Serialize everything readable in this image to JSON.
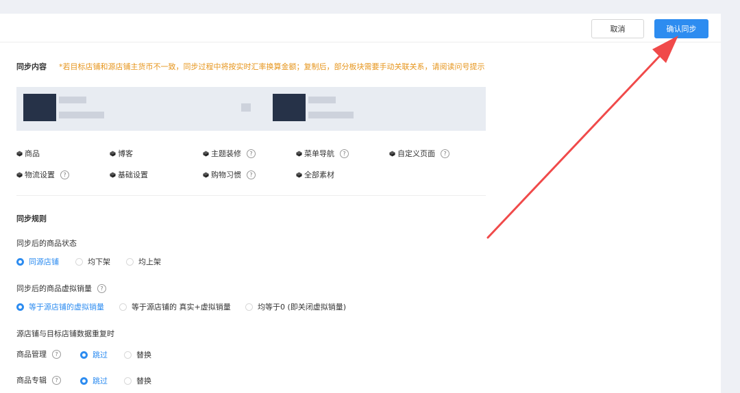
{
  "toolbar": {
    "cancel_label": "取消",
    "confirm_label": "确认同步"
  },
  "content": {
    "title": "同步内容",
    "warning": "*若目标店铺和源店铺主货币不一致，同步过程中将按实时汇率换算金额；复制后，部分板块需要手动关联关系，请阅读问号提示",
    "items": [
      {
        "label": "商品",
        "help": false
      },
      {
        "label": "博客",
        "help": false
      },
      {
        "label": "主题装修",
        "help": true
      },
      {
        "label": "菜单导航",
        "help": true
      },
      {
        "label": "自定义页面",
        "help": true
      },
      {
        "label": "物流设置",
        "help": true
      },
      {
        "label": "基础设置",
        "help": false
      },
      {
        "label": "购物习惯",
        "help": true
      },
      {
        "label": "全部素材",
        "help": false
      }
    ]
  },
  "rules": {
    "title": "同步规则",
    "status": {
      "label": "同步后的商品状态",
      "options": [
        "同源店铺",
        "均下架",
        "均上架"
      ],
      "selected": 0
    },
    "virtual_sales": {
      "label": "同步后的商品虚拟销量",
      "options": [
        "等于源店铺的虚拟销量",
        "等于源店铺的 真实+虚拟销量",
        "均等于0 (即关闭虚拟销量)"
      ],
      "selected": 0
    },
    "duplicate": {
      "label": "源店铺与目标店铺数据重复时"
    },
    "product_mgmt": {
      "label": "商品管理",
      "options": [
        "跳过",
        "替换"
      ],
      "selected": 0
    },
    "product_album": {
      "label": "商品专辑",
      "options": [
        "跳过",
        "替换"
      ],
      "selected": 0
    }
  },
  "help_glyph": "?",
  "colors": {
    "accent": "#2d8cf0",
    "warning": "#e6951c",
    "annotation_arrow": "#f04a4a"
  }
}
